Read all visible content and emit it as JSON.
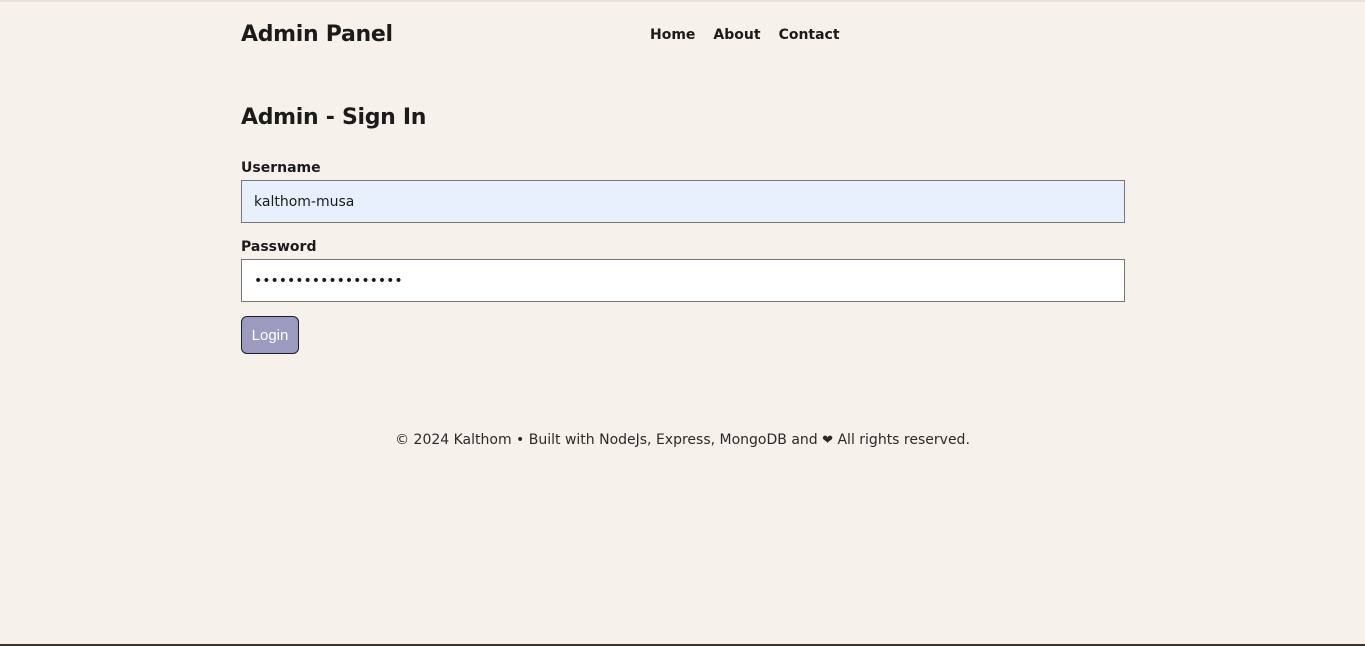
{
  "header": {
    "brand": "Admin Panel",
    "nav": [
      {
        "label": "Home"
      },
      {
        "label": "About"
      },
      {
        "label": "Contact"
      }
    ]
  },
  "main": {
    "title": "Admin - Sign In",
    "username": {
      "label": "Username",
      "value": "kalthom-musa"
    },
    "password": {
      "label": "Password",
      "value": "••••••••••••••••••"
    },
    "login_label": "Login"
  },
  "footer": {
    "text_before": "© 2024 Kalthom • Built with NodeJs, Express, MongoDB and",
    "heart_icon": "heart-icon",
    "heart_glyph": "❤",
    "text_after": "All rights reserved."
  },
  "colors": {
    "background": "#f6f1eb",
    "username_field_bg": "#e8f0fe",
    "button_bg": "#9b9bbf"
  }
}
